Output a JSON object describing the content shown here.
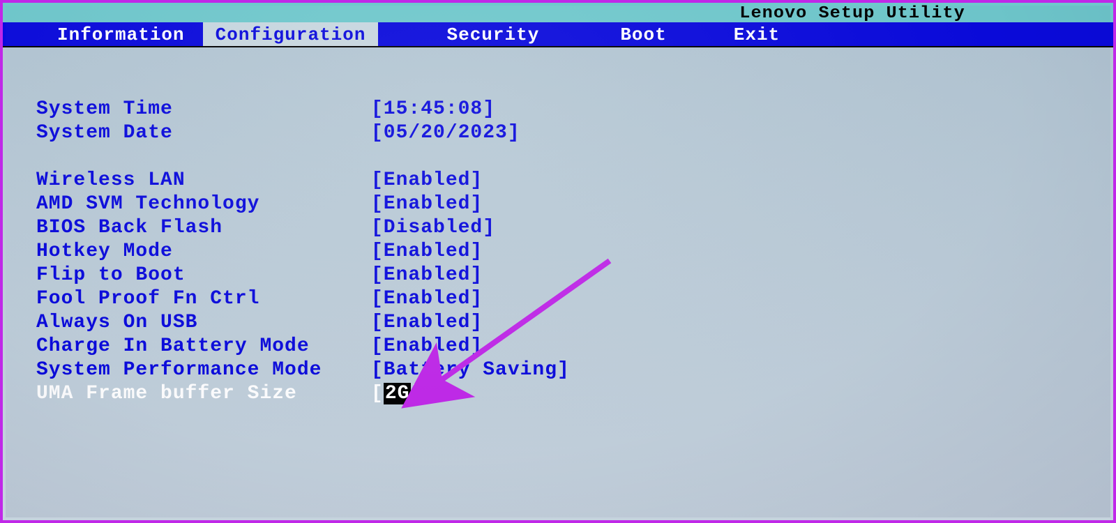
{
  "title": "Lenovo Setup Utility",
  "tabs": {
    "information": "Information",
    "configuration": "Configuration",
    "security": "Security",
    "boot": "Boot",
    "exit": "Exit"
  },
  "fields": {
    "system_time": {
      "label": "System Time",
      "value": "[15:45:08]"
    },
    "system_date": {
      "label": "System Date",
      "value": "[05/20/2023]"
    },
    "wireless_lan": {
      "label": "Wireless LAN",
      "value": "[Enabled]"
    },
    "amd_svm": {
      "label": "AMD SVM Technology",
      "value": "[Enabled]"
    },
    "bios_back_flash": {
      "label": "BIOS Back Flash",
      "value": "[Disabled]"
    },
    "hotkey_mode": {
      "label": "Hotkey Mode",
      "value": "[Enabled]"
    },
    "flip_to_boot": {
      "label": "Flip to Boot",
      "value": "[Enabled]"
    },
    "fool_proof_fn": {
      "label": "Fool Proof Fn Ctrl",
      "value": "[Enabled]"
    },
    "always_on_usb": {
      "label": "Always On USB",
      "value": "[Enabled]"
    },
    "charge_in_batt": {
      "label": "Charge In Battery Mode",
      "value": "[Enabled]"
    },
    "sys_perf_mode": {
      "label": "System Performance Mode",
      "value": "[Battery Saving]"
    },
    "uma_frame_buf": {
      "label": "UMA Frame buffer Size",
      "value_open": "[",
      "value_inner": "2G",
      "value_close": "]"
    }
  },
  "annotation": {
    "arrow_color": "#c028e8"
  }
}
